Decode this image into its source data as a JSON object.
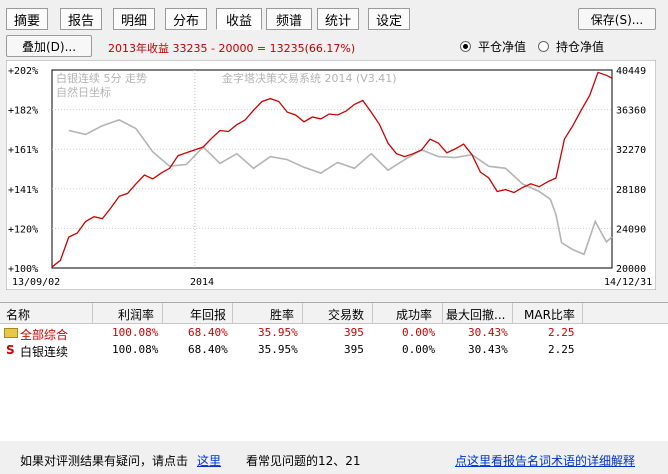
{
  "tabs": [
    "摘要",
    "报告",
    "明细",
    "分布",
    "收益",
    "频谱",
    "统计",
    "设定"
  ],
  "active_tab": "收益",
  "save_button": "保存(S)...",
  "overlay_button": "叠加(D)...",
  "summary_text": "2013年收益 33235 - 20000 = 13235(66.17%)",
  "radio_options": [
    {
      "label": "平仓净值",
      "selected": true
    },
    {
      "label": "持仓净值",
      "selected": false
    }
  ],
  "chart": {
    "watermark_left_1": "白银连续 5分 走势",
    "watermark_left_2": "自然日坐标",
    "watermark_center": "金字塔决策交易系统 2014 (V3.41)",
    "left_ticks": [
      "+202%",
      "+182%",
      "+161%",
      "+141%",
      "+120%",
      "+100%"
    ],
    "right_ticks": [
      "40449",
      "36360",
      "32270",
      "28180",
      "24090",
      "20000"
    ],
    "x_start": "13/09/02",
    "x_mid": "2014",
    "x_end": "14/12/31"
  },
  "chart_data": {
    "type": "line",
    "x_start": "13/09/02",
    "x_end": "14/12/31",
    "ylim_left": [
      100,
      202
    ],
    "ylim_right": [
      20000,
      40449
    ],
    "series": [
      {
        "color": "#cc0000",
        "points": [
          [
            0,
            20100
          ],
          [
            1.5,
            20800
          ],
          [
            3,
            23200
          ],
          [
            4.5,
            23600
          ],
          [
            6,
            24800
          ],
          [
            7.5,
            25300
          ],
          [
            9,
            25100
          ],
          [
            10.5,
            26200
          ],
          [
            12,
            27400
          ],
          [
            13.5,
            27700
          ],
          [
            15,
            28700
          ],
          [
            16.5,
            29600
          ],
          [
            18,
            29200
          ],
          [
            19.5,
            29800
          ],
          [
            21,
            30300
          ],
          [
            22.5,
            31600
          ],
          [
            24,
            31900
          ],
          [
            25.5,
            32200
          ],
          [
            27,
            32500
          ],
          [
            28.5,
            33400
          ],
          [
            30,
            34200
          ],
          [
            31.5,
            34100
          ],
          [
            33,
            34800
          ],
          [
            34.5,
            35300
          ],
          [
            36,
            36300
          ],
          [
            37.5,
            37200
          ],
          [
            39,
            37500
          ],
          [
            40.5,
            37200
          ],
          [
            42,
            36100
          ],
          [
            43.5,
            35800
          ],
          [
            45,
            35100
          ],
          [
            46.5,
            35600
          ],
          [
            48,
            35400
          ],
          [
            49.5,
            35900
          ],
          [
            51,
            35800
          ],
          [
            52.5,
            36200
          ],
          [
            54,
            36900
          ],
          [
            55.5,
            37300
          ],
          [
            57,
            36100
          ],
          [
            58.5,
            34800
          ],
          [
            60,
            32900
          ],
          [
            61.5,
            31800
          ],
          [
            63,
            31500
          ],
          [
            64.5,
            31800
          ],
          [
            66,
            32200
          ],
          [
            67.5,
            33300
          ],
          [
            69,
            32900
          ],
          [
            70.5,
            31900
          ],
          [
            72,
            32300
          ],
          [
            73.5,
            32800
          ],
          [
            75,
            31700
          ],
          [
            76.5,
            29900
          ],
          [
            78,
            29300
          ],
          [
            79.5,
            27900
          ],
          [
            81,
            28100
          ],
          [
            82.5,
            27800
          ],
          [
            84,
            28300
          ],
          [
            85.5,
            28700
          ],
          [
            87,
            28400
          ],
          [
            88.5,
            28900
          ],
          [
            90,
            29300
          ],
          [
            91.5,
            33300
          ],
          [
            93,
            34700
          ],
          [
            94.5,
            36300
          ],
          [
            96,
            37800
          ],
          [
            97.5,
            40200
          ],
          [
            99,
            39900
          ],
          [
            100,
            39600
          ]
        ]
      },
      {
        "color": "#b4b4b4",
        "points": [
          [
            3,
            34200
          ],
          [
            6,
            33800
          ],
          [
            9,
            34700
          ],
          [
            12,
            35300
          ],
          [
            15,
            34400
          ],
          [
            18,
            32000
          ],
          [
            21,
            30500
          ],
          [
            24,
            30700
          ],
          [
            27,
            32500
          ],
          [
            30,
            30800
          ],
          [
            33,
            31800
          ],
          [
            36,
            30300
          ],
          [
            39,
            31500
          ],
          [
            42,
            31200
          ],
          [
            45,
            30400
          ],
          [
            48,
            29800
          ],
          [
            51,
            30900
          ],
          [
            54,
            30300
          ],
          [
            57,
            31800
          ],
          [
            60,
            30100
          ],
          [
            63,
            31200
          ],
          [
            66,
            32200
          ],
          [
            69,
            31500
          ],
          [
            72,
            31400
          ],
          [
            75,
            31700
          ],
          [
            78,
            30500
          ],
          [
            81,
            30300
          ],
          [
            84,
            28700
          ],
          [
            87,
            27900
          ],
          [
            89,
            27100
          ],
          [
            90,
            25500
          ],
          [
            91,
            22600
          ],
          [
            93,
            21900
          ],
          [
            95,
            21400
          ],
          [
            97,
            24800
          ],
          [
            99,
            22700
          ],
          [
            100,
            23200
          ]
        ]
      }
    ]
  },
  "table": {
    "headers": [
      "名称",
      "利润率",
      "年回报",
      "胜率",
      "交易数",
      "成功率",
      "最大回撤...",
      "MAR比率"
    ],
    "rows": [
      {
        "name": "全部综合",
        "cells": [
          "100.08%",
          "68.40%",
          "35.95%",
          "395",
          "0.00%",
          "30.43%",
          "2.25"
        ],
        "color": "#cc0000"
      },
      {
        "name": "白银连续",
        "cells": [
          "100.08%",
          "68.40%",
          "35.95%",
          "395",
          "0.00%",
          "30.43%",
          "2.25"
        ],
        "color": "#000000"
      }
    ]
  },
  "footer": {
    "q_text": "如果对评测结果有疑问，请点击",
    "q_link": "这里",
    "faq": "看常见问题的12、21",
    "detail_link": "点这里看报告名词术语的详细解释"
  }
}
